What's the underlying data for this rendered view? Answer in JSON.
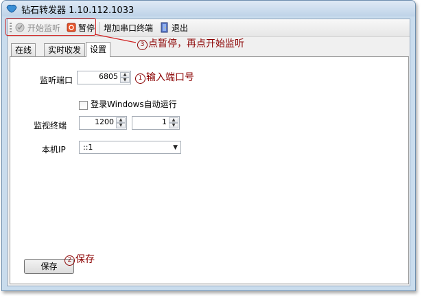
{
  "window": {
    "title": "钻石转发器 1.10.112.1033"
  },
  "toolbar": {
    "start_label": "开始监听",
    "pause_label": "暂停",
    "add_terminal_label": "增加串口终端",
    "exit_label": "退出"
  },
  "tabs": [
    {
      "label": "在线"
    },
    {
      "label": "实时收发"
    },
    {
      "label": "设置"
    }
  ],
  "settings": {
    "listen_port_label": "监听端口",
    "listen_port_value": "6805",
    "autorun_label": "登录Windows自动运行",
    "autorun_checked": false,
    "monitor_label": "监视终端",
    "monitor_value_1": "1200",
    "monitor_value_2": "1",
    "local_ip_label": "本机IP",
    "local_ip_value": "::1",
    "save_label": "保存"
  },
  "annotations": {
    "step1": {
      "num": "1",
      "text": "输入端口号"
    },
    "step2": {
      "num": "2",
      "text": "保存"
    },
    "step3": {
      "num": "3",
      "text": "点暂停，再点开始监听"
    }
  },
  "colors": {
    "annotation": "#8b0000",
    "highlight": "#d02020",
    "window_frame": "#c9dced"
  }
}
